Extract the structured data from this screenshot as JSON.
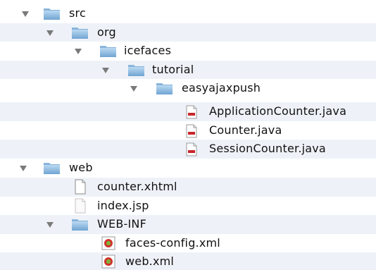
{
  "tree": {
    "src": {
      "label": "src",
      "icon": "folder-icon",
      "expanded": true
    },
    "org": {
      "label": "org",
      "icon": "folder-icon",
      "expanded": true
    },
    "icefaces": {
      "label": "icefaces",
      "icon": "folder-icon",
      "expanded": true
    },
    "tutorial": {
      "label": "tutorial",
      "icon": "folder-icon",
      "expanded": true
    },
    "easyajaxpush": {
      "label": "easyajaxpush",
      "icon": "folder-icon",
      "expanded": true
    },
    "application_counter": {
      "label": "ApplicationCounter.java",
      "icon": "java-file-icon"
    },
    "counter": {
      "label": "Counter.java",
      "icon": "java-file-icon"
    },
    "session_counter": {
      "label": "SessionCounter.java",
      "icon": "java-file-icon"
    },
    "web": {
      "label": "web",
      "icon": "folder-icon",
      "expanded": true
    },
    "counter_xhtml": {
      "label": "counter.xhtml",
      "icon": "document-icon"
    },
    "index_jsp": {
      "label": "index.jsp",
      "icon": "document-icon"
    },
    "web_inf": {
      "label": "WEB-INF",
      "icon": "folder-icon",
      "expanded": true
    },
    "faces_config": {
      "label": "faces-config.xml",
      "icon": "xml-file-icon"
    },
    "web_xml": {
      "label": "web.xml",
      "icon": "xml-file-icon"
    }
  },
  "colors": {
    "row_alt": "#eef2f8",
    "folder_light": "#a9cdea",
    "folder_dark": "#5f97c7",
    "disclosure": "#7a7a7a",
    "java_red": "#c8262b",
    "xml_red": "#d0342c",
    "xml_green": "#7cb83a"
  }
}
